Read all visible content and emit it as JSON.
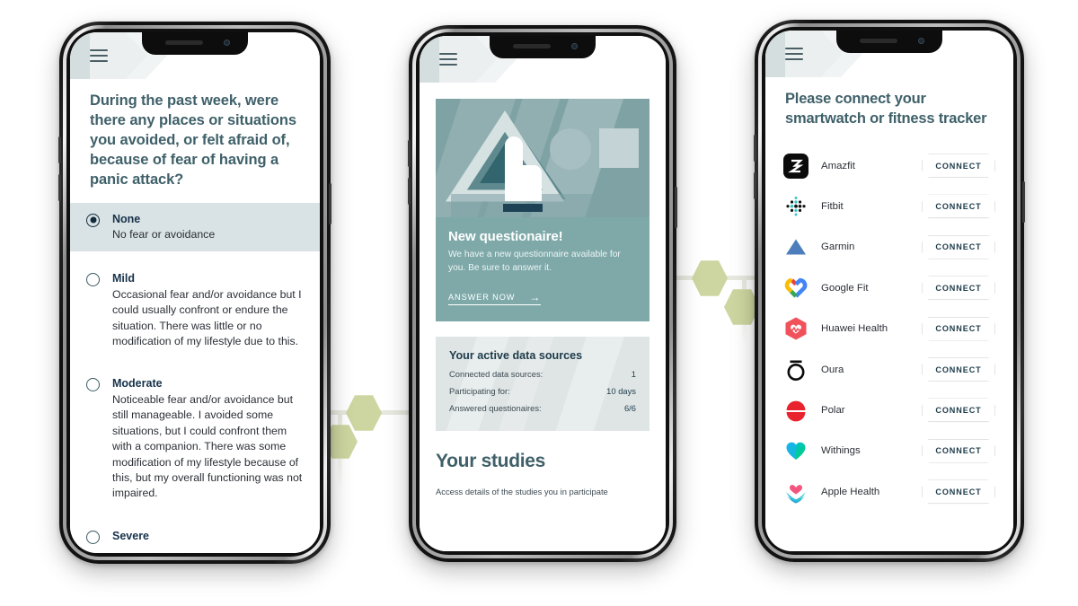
{
  "phone1": {
    "menu_icon": "hamburger-menu-icon",
    "question": "During the past week, were there any places or situations you avoided, or felt afraid of, because of fear of having a panic attack?",
    "options": [
      {
        "label": "None",
        "desc": "No fear or avoidance",
        "selected": true
      },
      {
        "label": "Mild",
        "desc": "Occasional fear and/or avoidance but I could usually confront or endure the situation. There was little or no modification of my lifestyle due to this.",
        "selected": false
      },
      {
        "label": "Moderate",
        "desc": "Noticeable fear and/or avoidance but still manageable. I avoided some situations, but I could confront them with a companion. There was some modification of my lifestyle because of this, but my overall functioning was not impaired.",
        "selected": false
      },
      {
        "label": "Severe",
        "desc": "",
        "selected": false
      }
    ]
  },
  "phone2": {
    "menu_icon": "hamburger-menu-icon",
    "banner": {
      "illustration": "hand-pointing-shapes-illustration",
      "heading": "New questionaire!",
      "body": "We have a new questionnaire available for you. Be sure to answer it.",
      "cta_label": "ANSWER NOW",
      "cta_icon": "arrow-right-icon"
    },
    "sources_card": {
      "heading": "Your active data sources",
      "rows": [
        {
          "label": "Connected data sources:",
          "value": "1"
        },
        {
          "label": "Participating for:",
          "value": "10 days"
        },
        {
          "label": "Answered questionaires:",
          "value": "6/6"
        }
      ]
    },
    "studies": {
      "heading": "Your studies",
      "body": "Access details of the studies you in participate"
    }
  },
  "phone3": {
    "menu_icon": "hamburger-menu-icon",
    "title": "Please connect your smartwatch or fitness tracker",
    "connect_label": "CONNECT",
    "devices": [
      {
        "name": "Amazfit",
        "icon": "amazfit-icon"
      },
      {
        "name": "Fitbit",
        "icon": "fitbit-icon"
      },
      {
        "name": "Garmin",
        "icon": "garmin-icon"
      },
      {
        "name": "Google Fit",
        "icon": "google-fit-icon"
      },
      {
        "name": "Huawei Health",
        "icon": "huawei-health-icon"
      },
      {
        "name": "Oura",
        "icon": "oura-icon"
      },
      {
        "name": "Polar",
        "icon": "polar-icon"
      },
      {
        "name": "Withings",
        "icon": "withings-icon"
      },
      {
        "name": "Apple Health",
        "icon": "apple-health-icon"
      }
    ]
  },
  "colors": {
    "heading_teal": "#3f6069",
    "selected_row": "#d9e2e4",
    "banner_teal": "#7fa9a9",
    "hexagon_green": "#cdd5a0",
    "dark_navy": "#17324a"
  }
}
